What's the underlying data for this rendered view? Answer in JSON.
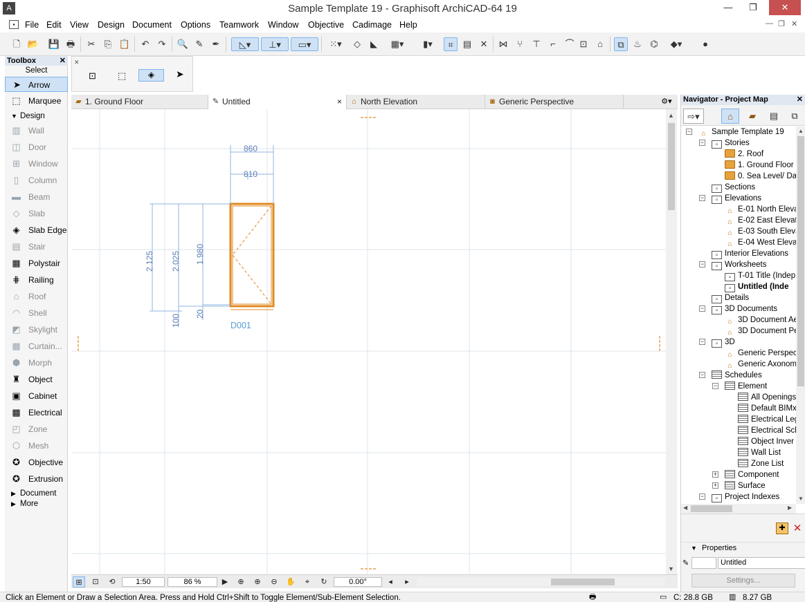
{
  "window": {
    "title": "Sample Template 19 - Graphisoft ArchiCAD-64 19"
  },
  "menu": [
    "File",
    "Edit",
    "View",
    "Design",
    "Document",
    "Options",
    "Teamwork",
    "Window",
    "Objective",
    "Cadimage",
    "Help"
  ],
  "toolbox": {
    "title": "Toolbox",
    "select_group": "Select",
    "design_group": "Design",
    "document_group": "Document",
    "more_group": "More",
    "select_tools": [
      {
        "label": "Arrow",
        "icon": "arrow-icon"
      },
      {
        "label": "Marquee",
        "icon": "marquee-icon"
      }
    ],
    "design_tools": [
      {
        "label": "Wall",
        "icon": "wall-icon"
      },
      {
        "label": "Door",
        "icon": "door-icon"
      },
      {
        "label": "Window",
        "icon": "window-icon"
      },
      {
        "label": "Column",
        "icon": "column-icon"
      },
      {
        "label": "Beam",
        "icon": "beam-icon"
      },
      {
        "label": "Slab",
        "icon": "slab-icon"
      },
      {
        "label": "Slab Edge",
        "icon": "slab-edge-icon"
      },
      {
        "label": "Stair",
        "icon": "stair-icon"
      },
      {
        "label": "Polystair",
        "icon": "polystair-icon"
      },
      {
        "label": "Railing",
        "icon": "railing-icon"
      },
      {
        "label": "Roof",
        "icon": "roof-icon"
      },
      {
        "label": "Shell",
        "icon": "shell-icon"
      },
      {
        "label": "Skylight",
        "icon": "skylight-icon"
      },
      {
        "label": "Curtain...",
        "icon": "curtain-wall-icon"
      },
      {
        "label": "Morph",
        "icon": "morph-icon"
      },
      {
        "label": "Object",
        "icon": "object-icon"
      },
      {
        "label": "Cabinet",
        "icon": "cabinet-icon"
      },
      {
        "label": "Electrical",
        "icon": "electrical-icon"
      },
      {
        "label": "Zone",
        "icon": "zone-icon"
      },
      {
        "label": "Mesh",
        "icon": "mesh-icon"
      },
      {
        "label": "Objective",
        "icon": "objective-icon"
      },
      {
        "label": "Extrusion",
        "icon": "extrusion-icon"
      }
    ]
  },
  "tabs": [
    {
      "label": "1. Ground Floor",
      "icon": "floor-plan-icon"
    },
    {
      "label": "Untitled",
      "icon": "worksheet-icon",
      "close": "×"
    },
    {
      "label": "North Elevation",
      "icon": "elevation-icon"
    },
    {
      "label": "Generic Perspective",
      "icon": "camera-icon"
    }
  ],
  "drawing": {
    "dims_top": [
      "860",
      "810"
    ],
    "dims_left": [
      "2.125",
      "2.025",
      "1.980"
    ],
    "dims_bottom": [
      "100",
      "20"
    ],
    "door_id": "D001"
  },
  "status_controls": {
    "scale": "1:50",
    "zoom": "86 %",
    "angle": "0.00°"
  },
  "navigator": {
    "title": "Navigator - Project Map",
    "tree": [
      {
        "label": "Sample Template 19",
        "icon": "house",
        "level": 0,
        "exp": "−"
      },
      {
        "label": "Stories",
        "icon": "box",
        "level": 1,
        "exp": "−"
      },
      {
        "label": "2. Roof",
        "icon": "folder",
        "level": 2
      },
      {
        "label": "1. Ground Floor",
        "icon": "folder",
        "level": 2
      },
      {
        "label": "0. Sea Level/ Da",
        "icon": "folder",
        "level": 2
      },
      {
        "label": "Sections",
        "icon": "box",
        "level": 1
      },
      {
        "label": "Elevations",
        "icon": "box",
        "level": 1,
        "exp": "−"
      },
      {
        "label": "E-01 North Eleva",
        "icon": "house",
        "level": 2
      },
      {
        "label": "E-02 East Elevati",
        "icon": "house",
        "level": 2
      },
      {
        "label": "E-03 South Eleva",
        "icon": "house",
        "level": 2
      },
      {
        "label": "E-04 West Eleva",
        "icon": "house",
        "level": 2
      },
      {
        "label": "Interior Elevations",
        "icon": "box",
        "level": 1
      },
      {
        "label": "Worksheets",
        "icon": "box",
        "level": 1,
        "exp": "−"
      },
      {
        "label": "T-01 Title (Indep",
        "icon": "box",
        "level": 2
      },
      {
        "label": "Untitled (Inde",
        "icon": "box",
        "level": 2,
        "bold": true
      },
      {
        "label": "Details",
        "icon": "box",
        "level": 1
      },
      {
        "label": "3D Documents",
        "icon": "box",
        "level": 1,
        "exp": "−"
      },
      {
        "label": "3D Document Ae",
        "icon": "house",
        "level": 2
      },
      {
        "label": "3D Document Per",
        "icon": "house",
        "level": 2
      },
      {
        "label": "3D",
        "icon": "box",
        "level": 1,
        "exp": "−"
      },
      {
        "label": "Generic Perspect",
        "icon": "house",
        "level": 2
      },
      {
        "label": "Generic Axonome",
        "icon": "house",
        "level": 2
      },
      {
        "label": "Schedules",
        "icon": "grid",
        "level": 1,
        "exp": "−"
      },
      {
        "label": "Element",
        "icon": "grid",
        "level": 2,
        "exp": "−"
      },
      {
        "label": "All Openings",
        "icon": "grid",
        "level": 3
      },
      {
        "label": "Default BIMx",
        "icon": "grid",
        "level": 3
      },
      {
        "label": "Electrical Leg",
        "icon": "grid",
        "level": 3
      },
      {
        "label": "Electrical Sch",
        "icon": "grid",
        "level": 3
      },
      {
        "label": "Object Inver",
        "icon": "grid",
        "level": 3
      },
      {
        "label": "Wall List",
        "icon": "grid",
        "level": 3
      },
      {
        "label": "Zone List",
        "icon": "grid",
        "level": 3
      },
      {
        "label": "Component",
        "icon": "grid",
        "level": 2,
        "exp": "+"
      },
      {
        "label": "Surface",
        "icon": "grid",
        "level": 2,
        "exp": "+"
      },
      {
        "label": "Project Indexes",
        "icon": "box",
        "level": 1,
        "exp": "−"
      }
    ],
    "properties_label": "Properties",
    "properties_value": "Untitled",
    "settings_label": "Settings..."
  },
  "status": {
    "hint": "Click an Element or Draw a Selection Area. Press and Hold Ctrl+Shift to Toggle Element/Sub-Element Selection.",
    "disk": "C: 28.8 GB",
    "memory": "8.27 GB"
  }
}
